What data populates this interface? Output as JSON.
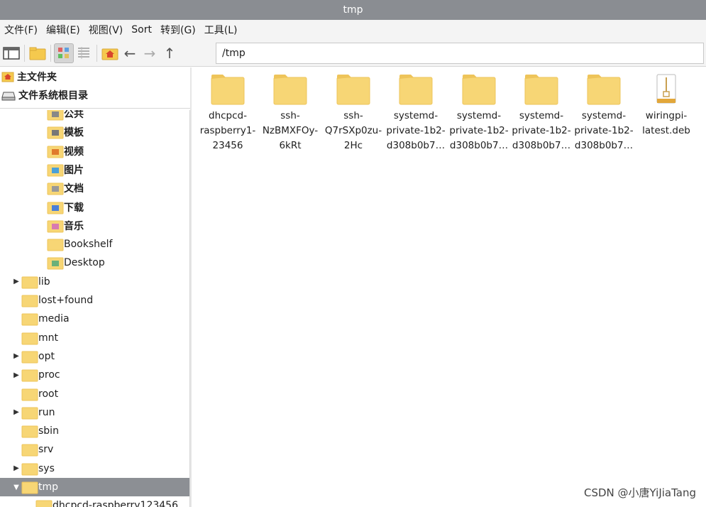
{
  "window": {
    "title": "tmp"
  },
  "menu": [
    "文件(F)",
    "编辑(E)",
    "视图(V)",
    "Sort",
    "转到(G)",
    "工具(L)"
  ],
  "location": {
    "path": "/tmp"
  },
  "places": [
    {
      "label": "主文件夹",
      "icon": "home-icon"
    },
    {
      "label": "文件系统根目录",
      "icon": "drive-icon"
    }
  ],
  "tree": [
    {
      "label": "公共",
      "icon": "public-folder-icon",
      "expander": ""
    },
    {
      "label": "模板",
      "icon": "templates-folder-icon",
      "expander": ""
    },
    {
      "label": "视频",
      "icon": "videos-folder-icon",
      "expander": ""
    },
    {
      "label": "图片",
      "icon": "pictures-folder-icon",
      "expander": ""
    },
    {
      "label": "文档",
      "icon": "documents-folder-icon",
      "expander": ""
    },
    {
      "label": "下载",
      "icon": "downloads-folder-icon",
      "expander": ""
    },
    {
      "label": "音乐",
      "icon": "music-folder-icon",
      "expander": ""
    },
    {
      "label": "Bookshelf",
      "icon": "folder-icon",
      "expander": ""
    },
    {
      "label": "Desktop",
      "icon": "desktop-folder-icon",
      "expander": ""
    },
    {
      "label": "lib",
      "icon": "folder-icon",
      "expander": "▶"
    },
    {
      "label": "lost+found",
      "icon": "folder-icon",
      "expander": ""
    },
    {
      "label": "media",
      "icon": "folder-icon",
      "expander": ""
    },
    {
      "label": "mnt",
      "icon": "folder-icon",
      "expander": ""
    },
    {
      "label": "opt",
      "icon": "folder-icon",
      "expander": "▶"
    },
    {
      "label": "proc",
      "icon": "folder-icon",
      "expander": "▶"
    },
    {
      "label": "root",
      "icon": "folder-icon",
      "expander": ""
    },
    {
      "label": "run",
      "icon": "folder-icon",
      "expander": "▶"
    },
    {
      "label": "sbin",
      "icon": "folder-icon",
      "expander": ""
    },
    {
      "label": "srv",
      "icon": "folder-icon",
      "expander": ""
    },
    {
      "label": "sys",
      "icon": "folder-icon",
      "expander": "▶"
    },
    {
      "label": "tmp",
      "icon": "folder-icon",
      "expander": "▼"
    },
    {
      "label": "dhcpcd-raspberry123456",
      "icon": "folder-icon",
      "expander": ""
    }
  ],
  "files": [
    {
      "lines": [
        "dhcpcd-",
        "raspberry1-",
        "23456"
      ],
      "icon": "folder-icon"
    },
    {
      "lines": [
        "ssh-",
        "NzBMXFOy-",
        "6kRt"
      ],
      "icon": "folder-icon"
    },
    {
      "lines": [
        "ssh-",
        "Q7rSXp0zu-",
        "2Hc"
      ],
      "icon": "folder-icon"
    },
    {
      "lines": [
        "systemd-",
        "private-1b2-",
        "d308b0b7…"
      ],
      "icon": "folder-icon"
    },
    {
      "lines": [
        "systemd-",
        "private-1b2-",
        "d308b0b7…"
      ],
      "icon": "folder-icon"
    },
    {
      "lines": [
        "systemd-",
        "private-1b2-",
        "d308b0b7…"
      ],
      "icon": "folder-icon"
    },
    {
      "lines": [
        "systemd-",
        "private-1b2-",
        "d308b0b7…"
      ],
      "icon": "folder-icon"
    },
    {
      "lines": [
        "wiringpi-",
        "latest.deb"
      ],
      "icon": "archive-icon"
    }
  ],
  "watermark": "CSDN @小唐YiJiaTang",
  "colors": {
    "folder": "#f7d675",
    "folder_dark": "#eec45a",
    "titlebar": "#8a8d92",
    "selected": "#8c8f94"
  }
}
